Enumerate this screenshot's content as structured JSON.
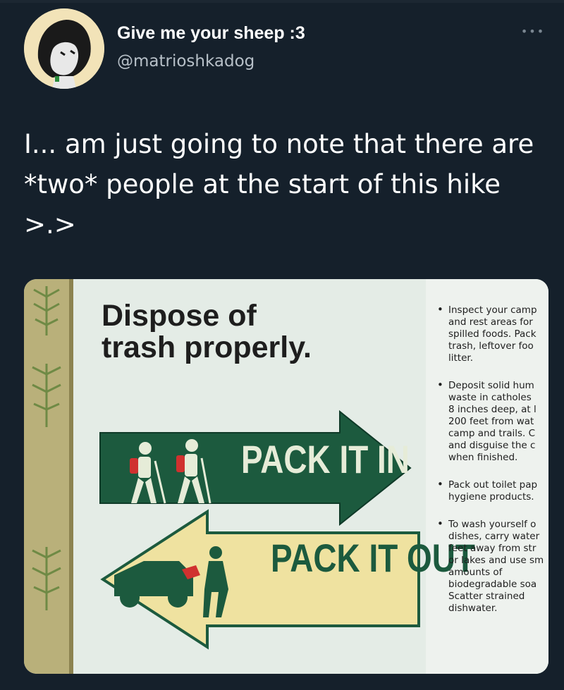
{
  "tweet": {
    "display_name": "Give me your sheep :3",
    "handle": "@matrioshkadog",
    "more_icon": "ellipsis-icon",
    "text": "I... am just going to note that there are *two* people at the start of this hike >.>"
  },
  "sign": {
    "title_line1": "Dispose of",
    "title_line2": "trash properly.",
    "pack_in": "PACK IT IN",
    "pack_out": "PACK IT OUT",
    "tips": [
      "Inspect your camp\nand rest areas for\nspilled foods. Pack\ntrash, leftover foo\nlitter.",
      "Deposit solid hum\nwaste in catholes\n8 inches deep, at l\n200 feet from wat\ncamp and trails. C\nand disguise the c\nwhen finished.",
      "Pack out toilet pap\nhygiene products.",
      "To wash yourself o\ndishes, carry water\nfeet away from str\nor lakes and use sm\namounts of\nbiodegradable soa\nScatter strained\ndishwater."
    ]
  },
  "colors": {
    "background": "#15202b",
    "sign_green": "#1c5a3e",
    "sign_cream": "#efe2a0",
    "hiker_red": "#d0312f"
  }
}
